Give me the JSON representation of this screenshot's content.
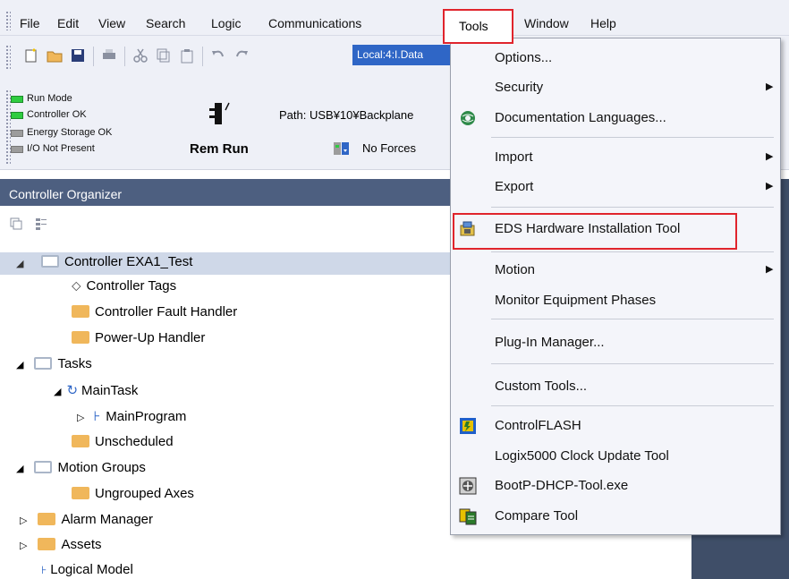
{
  "menubar": {
    "items": [
      "File",
      "Edit",
      "View",
      "Search",
      "Logic",
      "Communications",
      "Tools",
      "Window",
      "Help"
    ]
  },
  "toolbar": {
    "path_combo": "Local:4:I.Data"
  },
  "status": {
    "indicators": [
      {
        "label": "Run Mode",
        "state": "green"
      },
      {
        "label": "Controller OK",
        "state": "green"
      },
      {
        "label": "Energy Storage OK",
        "state": "gray"
      },
      {
        "label": "I/O Not Present",
        "state": "gray"
      }
    ],
    "mode": "Rem Run",
    "forces": "No Forces",
    "path": "Path: USB¥10¥Backplane"
  },
  "organizer": {
    "title": "Controller Organizer",
    "tree": [
      {
        "label": "Controller EXA1_Test"
      },
      {
        "label": "Controller Tags"
      },
      {
        "label": "Controller Fault Handler"
      },
      {
        "label": "Power-Up Handler"
      },
      {
        "label": "Tasks"
      },
      {
        "label": "MainTask"
      },
      {
        "label": "MainProgram"
      },
      {
        "label": "Unscheduled"
      },
      {
        "label": "Motion Groups"
      },
      {
        "label": "Ungrouped Axes"
      },
      {
        "label": "Alarm Manager"
      },
      {
        "label": "Assets"
      },
      {
        "label": "Logical Model"
      }
    ]
  },
  "tools_menu": {
    "items": [
      {
        "label": "Options..."
      },
      {
        "label": "Security"
      },
      {
        "label": "Documentation Languages..."
      },
      {
        "label": "Import"
      },
      {
        "label": "Export"
      },
      {
        "label": "EDS Hardware Installation Tool"
      },
      {
        "label": "Motion"
      },
      {
        "label": "Monitor Equipment Phases"
      },
      {
        "label": "Plug-In Manager..."
      },
      {
        "label": "Custom Tools..."
      },
      {
        "label": "ControlFLASH"
      },
      {
        "label": "Logix5000 Clock Update Tool"
      },
      {
        "label": "BootP-DHCP-Tool.exe"
      },
      {
        "label": "Compare Tool"
      }
    ]
  },
  "colors": {
    "highlight_box": "#e0242c",
    "organizer_header": "#4d5f80",
    "path_combo_bg": "#2f66c6"
  }
}
